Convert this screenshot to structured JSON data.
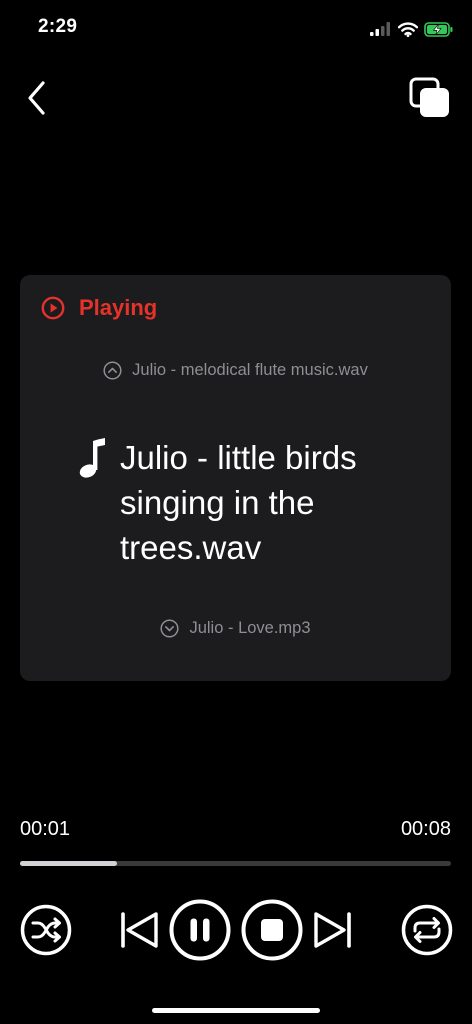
{
  "status_bar": {
    "time": "2:29",
    "icons": [
      "cellular-signal-icon",
      "wifi-icon",
      "battery-charging-icon"
    ],
    "battery_color": "#34c759"
  },
  "header": {
    "back_icon": "chevron-left-icon",
    "action_icon": "copy-icon"
  },
  "player_card": {
    "status_label": "Playing",
    "status_icon": "play-circle-icon",
    "accent_color": "#e5332a",
    "previous_track": "Julio - melodical flute music.wav",
    "current_track": "Julio - little birds singing in the trees.wav",
    "next_track": "Julio - Love.mp3"
  },
  "playback": {
    "elapsed": "00:01",
    "total": "00:08",
    "progress_fraction": 0.225
  },
  "controls": [
    "shuffle-icon",
    "previous-icon",
    "pause-icon",
    "stop-icon",
    "next-icon",
    "repeat-icon"
  ]
}
